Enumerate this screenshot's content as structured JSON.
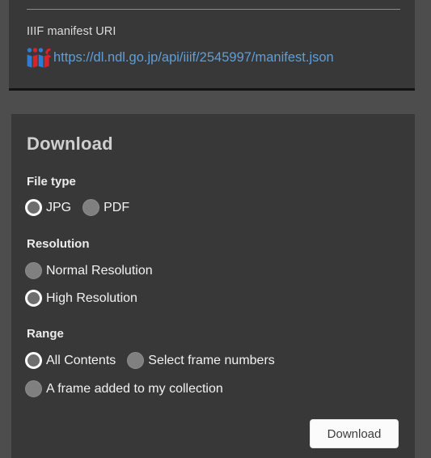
{
  "manifest": {
    "label": "IIIF manifest URI",
    "url": "https://dl.ndl.go.jp/api/iiif/2545997/manifest.json",
    "logo_name": "iiif-logo",
    "link_color": "#5e9fd8"
  },
  "download": {
    "title": "Download",
    "groups": {
      "file_type": {
        "label": "File type",
        "options": [
          {
            "label": "JPG",
            "selected": true
          },
          {
            "label": "PDF",
            "selected": false
          }
        ]
      },
      "resolution": {
        "label": "Resolution",
        "options": [
          {
            "label": "Normal Resolution",
            "selected": false
          },
          {
            "label": "High Resolution",
            "selected": true
          }
        ]
      },
      "range": {
        "label": "Range",
        "options": [
          {
            "label": "All Contents",
            "selected": true
          },
          {
            "label": "Select frame numbers",
            "selected": false
          },
          {
            "label": "A frame added to my collection",
            "selected": false
          }
        ]
      }
    },
    "button_label": "Download"
  },
  "colors": {
    "page_background": "#4d4d4d",
    "panel_background": "#383838",
    "link": "#5e9fd8",
    "text": "#f2f2f2",
    "title": "#cfcfcf",
    "radio_off": "#808080",
    "radio_on_ring": "#fefefe",
    "button_background": "#fbfbfb",
    "button_text": "#3c3c3c"
  }
}
